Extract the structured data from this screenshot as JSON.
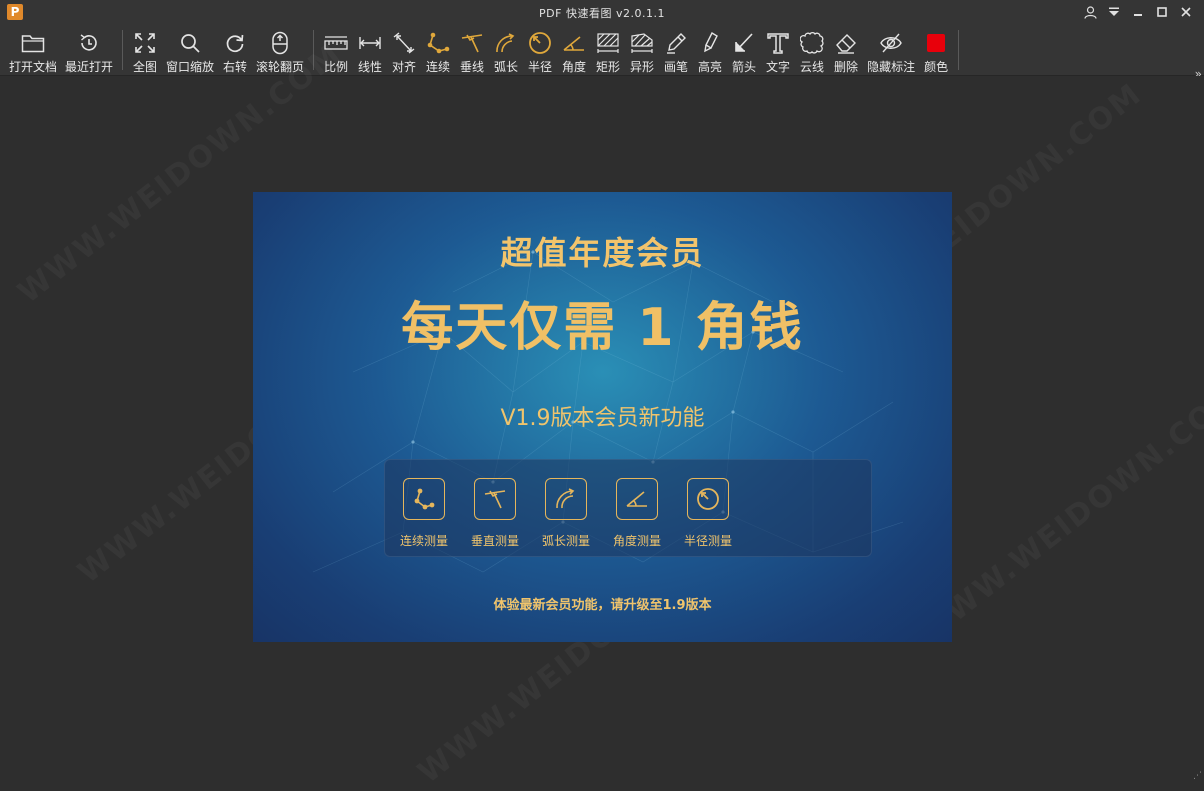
{
  "app": {
    "logo_letter": "P",
    "title": "PDF 快速看图 v2.0.1.1"
  },
  "window_controls": [
    "user-icon",
    "menu-dropdown-icon",
    "minimize-icon",
    "maximize-icon",
    "close-icon"
  ],
  "toolbar": {
    "open": "打开文档",
    "recent": "最近打开",
    "fit": "全图",
    "zoom_window": "窗口缩放",
    "rotate_right": "右转",
    "wheel_page": "滚轮翻页",
    "scale": "比例",
    "linear": "线性",
    "align": "对齐",
    "continuous": "连续",
    "perpendicular": "垂线",
    "arc_length": "弧长",
    "radius": "半径",
    "angle": "角度",
    "rectangle": "矩形",
    "irregular": "异形",
    "pen": "画笔",
    "highlight": "高亮",
    "arrow": "箭头",
    "text": "文字",
    "cloud": "云线",
    "delete": "删除",
    "hide_marks": "隐藏标注",
    "color": "颜色",
    "color_value": "#e8000b",
    "more": "»"
  },
  "banner": {
    "line1": "超值年度会员",
    "line2": "每天仅需 1 角钱",
    "line3": "V1.9版本会员新功能",
    "features": [
      {
        "label": "连续测量",
        "icon": "continuous-measure-icon"
      },
      {
        "label": "垂直测量",
        "icon": "perpendicular-measure-icon"
      },
      {
        "label": "弧长测量",
        "icon": "arc-measure-icon"
      },
      {
        "label": "角度测量",
        "icon": "angle-measure-icon"
      },
      {
        "label": "半径测量",
        "icon": "radius-measure-icon"
      }
    ],
    "footer": "体验最新会员功能，请升级至1.9版本",
    "accent": "#f0c46c"
  }
}
